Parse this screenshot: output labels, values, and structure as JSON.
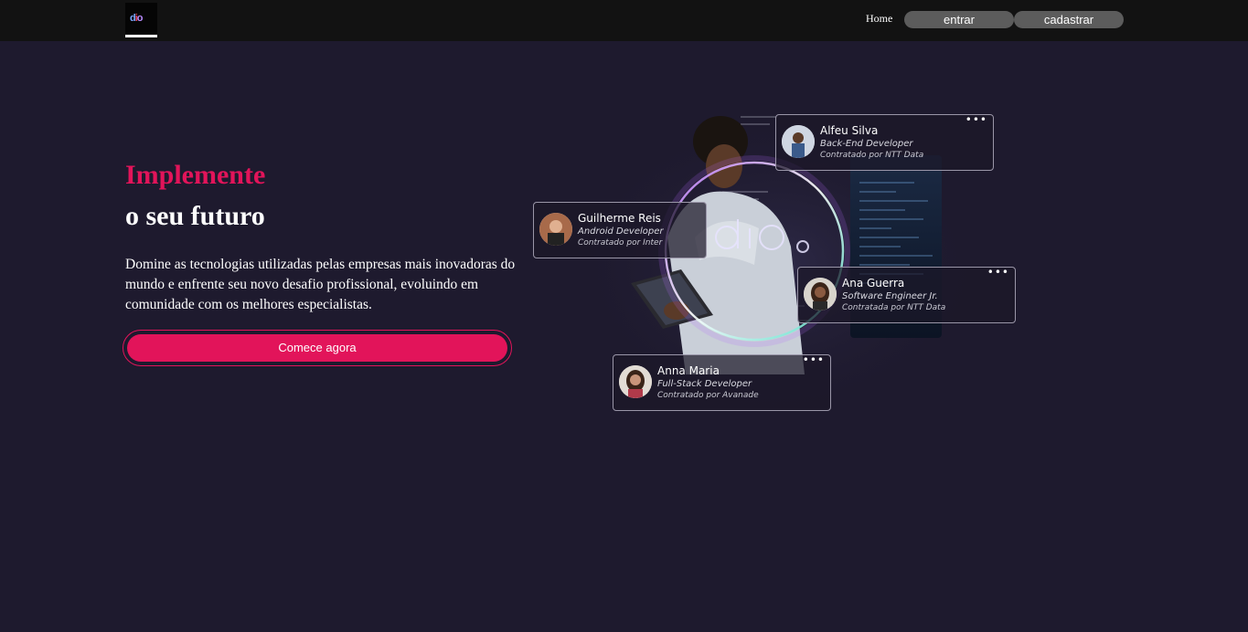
{
  "header": {
    "nav_home": "Home",
    "btn_login": "entrar",
    "btn_signup": "cadastrar",
    "logo_icon": "dio-logo-icon"
  },
  "hero": {
    "title_line1": "Implemente",
    "title_line2": "o seu futuro",
    "description": "Domine as tecnologias utilizadas pelas empresas mais inovadoras do mundo e enfrente seu novo desafio profissional, evoluindo em comunidade com os melhores especialistas.",
    "cta_label": "Comece agora"
  },
  "profiles": [
    {
      "name": "Alfeu Silva",
      "role": "Back-End Developer",
      "hired": "Contratado por NTT Data"
    },
    {
      "name": "Guilherme Reis",
      "role": "Android Developer",
      "hired": "Contratado por Inter"
    },
    {
      "name": "Ana Guerra",
      "role": "Software Engineer Jr.",
      "hired": "Contratada por NTT Data"
    },
    {
      "name": "Anna Maria",
      "role": "Full-Stack Developer",
      "hired": "Contratado por Avanade"
    }
  ],
  "colors": {
    "background": "#1e1a2e",
    "header": "#121212",
    "accent": "#e2145a",
    "nav_button": "#5c5c5c"
  }
}
